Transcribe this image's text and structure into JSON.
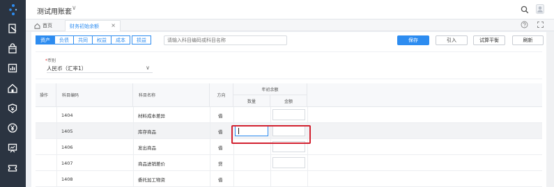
{
  "app": {
    "title": "测试用账套"
  },
  "tabs": {
    "home_label": "首页",
    "active_label": "财务初始余额"
  },
  "categories": [
    "资产",
    "负债",
    "共同",
    "权益",
    "成本",
    "损益"
  ],
  "search": {
    "placeholder": "请输入科目编码或科目名称"
  },
  "toolbar": {
    "save": "保存",
    "import": "引入",
    "trial_balance": "试算平衡",
    "refresh": "刷新"
  },
  "currency": {
    "label": "币别",
    "required_mark": "*",
    "value": "人民币（汇率1）"
  },
  "table": {
    "headers": {
      "op": "操作",
      "code": "科目编码",
      "name": "科目名称",
      "direction": "方向",
      "opening_group": "年初余额",
      "qty": "数量",
      "amount": "金额"
    },
    "rows": [
      {
        "code": "1404",
        "name": "材料成本差异",
        "direction": "借"
      },
      {
        "code": "1405",
        "name": "库存商品",
        "direction": "借"
      },
      {
        "code": "1406",
        "name": "发出商品",
        "direction": "借"
      },
      {
        "code": "1407",
        "name": "商品进销差价",
        "direction": "贷"
      },
      {
        "code": "1408",
        "name": "委托加工物资",
        "direction": "借"
      }
    ]
  },
  "colors": {
    "primary": "#2d8cf0",
    "sidebar": "#2b3441",
    "highlight": "#d2202f"
  },
  "icons": {
    "sidebar": [
      "logo-icon",
      "voucher-icon",
      "bag-icon",
      "report-icon",
      "home-icon",
      "assets-icon",
      "yen-icon",
      "monitor-icon",
      "ticket-icon"
    ],
    "top": [
      "search-icon",
      "avatar-icon"
    ],
    "tabbar_right": [
      "help-icon",
      "fullscreen-icon"
    ]
  }
}
